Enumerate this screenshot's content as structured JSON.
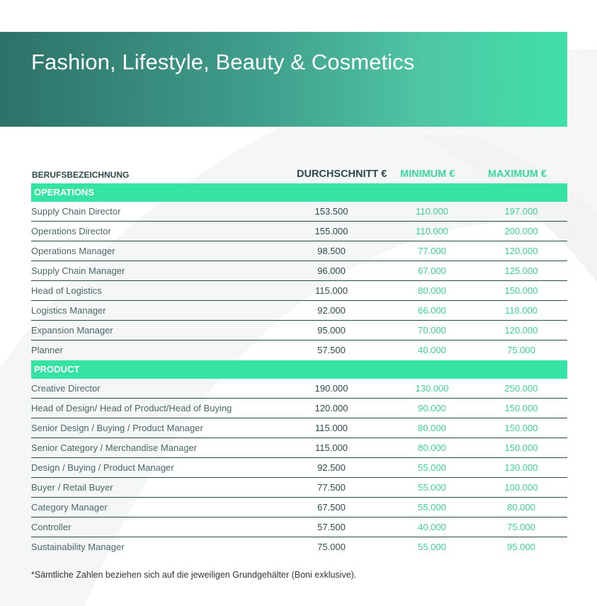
{
  "banner": {
    "title": "Fashion, Lifestyle, Beauty & Cosmetics"
  },
  "table": {
    "headers": {
      "title": "BERUFSBEZEICHNUNG",
      "avg": "DURCHSCHNITT €",
      "min": "MINIMUM €",
      "max": "MAXIMUM €"
    },
    "sections": [
      {
        "name": "OPERATIONS",
        "rows": [
          {
            "title": "Supply Chain Director",
            "avg": "153.500",
            "min": "110.000",
            "max": "197.000"
          },
          {
            "title": "Operations Director",
            "avg": "155.000",
            "min": "110.000",
            "max": "200.000"
          },
          {
            "title": "Operations Manager",
            "avg": "98.500",
            "min": "77.000",
            "max": "120.000"
          },
          {
            "title": "Supply Chain Manager",
            "avg": "96.000",
            "min": "67.000",
            "max": "125.000"
          },
          {
            "title": "Head of Logistics",
            "avg": "115.000",
            "min": "80.000",
            "max": "150.000"
          },
          {
            "title": "Logistics Manager",
            "avg": "92.000",
            "min": "66.000",
            "max": "118.000"
          },
          {
            "title": "Expansion Manager",
            "avg": "95.000",
            "min": "70.000",
            "max": "120.000"
          },
          {
            "title": "Planner",
            "avg": "57.500",
            "min": "40.000",
            "max": "75.000"
          }
        ]
      },
      {
        "name": "PRODUCT",
        "rows": [
          {
            "title": "Creative Director",
            "avg": "190.000",
            "min": "130.000",
            "max": "250.000"
          },
          {
            "title": "Head of Design/ Head of Product/Head of Buying",
            "avg": "120.000",
            "min": "90.000",
            "max": "150.000"
          },
          {
            "title": "Senior Design / Buying / Product Manager",
            "avg": "115.000",
            "min": "80.000",
            "max": "150.000"
          },
          {
            "title": "Senior Category / Merchandise Manager",
            "avg": "115.000",
            "min": "80.000",
            "max": "150.000"
          },
          {
            "title": "Design / Buying / Product Manager",
            "avg": "92.500",
            "min": "55.000",
            "max": "130.000"
          },
          {
            "title": "Buyer / Retail Buyer",
            "avg": "77.500",
            "min": "55.000",
            "max": "100.000"
          },
          {
            "title": "Category Manager",
            "avg": "67.500",
            "min": "55.000",
            "max": "80.000"
          },
          {
            "title": "Controller",
            "avg": "57.500",
            "min": "40.000",
            "max": "75.000"
          },
          {
            "title": "Sustainability Manager",
            "avg": "75.000",
            "min": "55.000",
            "max": "95.000"
          }
        ]
      }
    ]
  },
  "footnote": "*Sämtliche Zahlen beziehen sich auf die jeweiligen Grundgehälter (Boni exklusive).",
  "colors": {
    "accent": "#35e3a4",
    "dark_text": "#2c4a4c",
    "banner_start": "#2d7268",
    "banner_end": "#40e0a8"
  }
}
